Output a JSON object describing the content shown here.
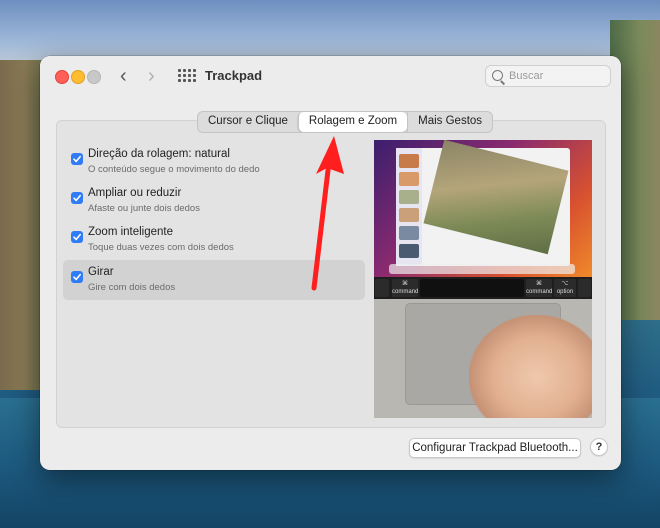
{
  "window": {
    "title": "Trackpad",
    "search_placeholder": "Buscar"
  },
  "tabs": [
    {
      "label": "Cursor e Clique",
      "active": false
    },
    {
      "label": "Rolagem e Zoom",
      "active": true
    },
    {
      "label": "Mais Gestos",
      "active": false
    }
  ],
  "options": [
    {
      "title": "Direção da rolagem: natural",
      "description": "O conteúdo segue o movimento do dedo",
      "checked": true
    },
    {
      "title": "Ampliar ou reduzir",
      "description": "Afaste ou junte dois dedos",
      "checked": true
    },
    {
      "title": "Zoom inteligente",
      "description": "Toque duas vezes com dois dedos",
      "checked": true
    },
    {
      "title": "Girar",
      "description": "Gire com dois dedos",
      "checked": true,
      "selected": true
    }
  ],
  "touchbar_keys": [
    "command",
    "command",
    "option"
  ],
  "footer": {
    "config_button": "Configurar Trackpad Bluetooth...",
    "help_button": "?"
  },
  "colors": {
    "accent": "#2f7cf6",
    "annotation_arrow": "#ff1f1f"
  },
  "icons": [
    "back-icon",
    "forward-icon",
    "grid-icon",
    "search-icon",
    "checkmark-icon"
  ]
}
